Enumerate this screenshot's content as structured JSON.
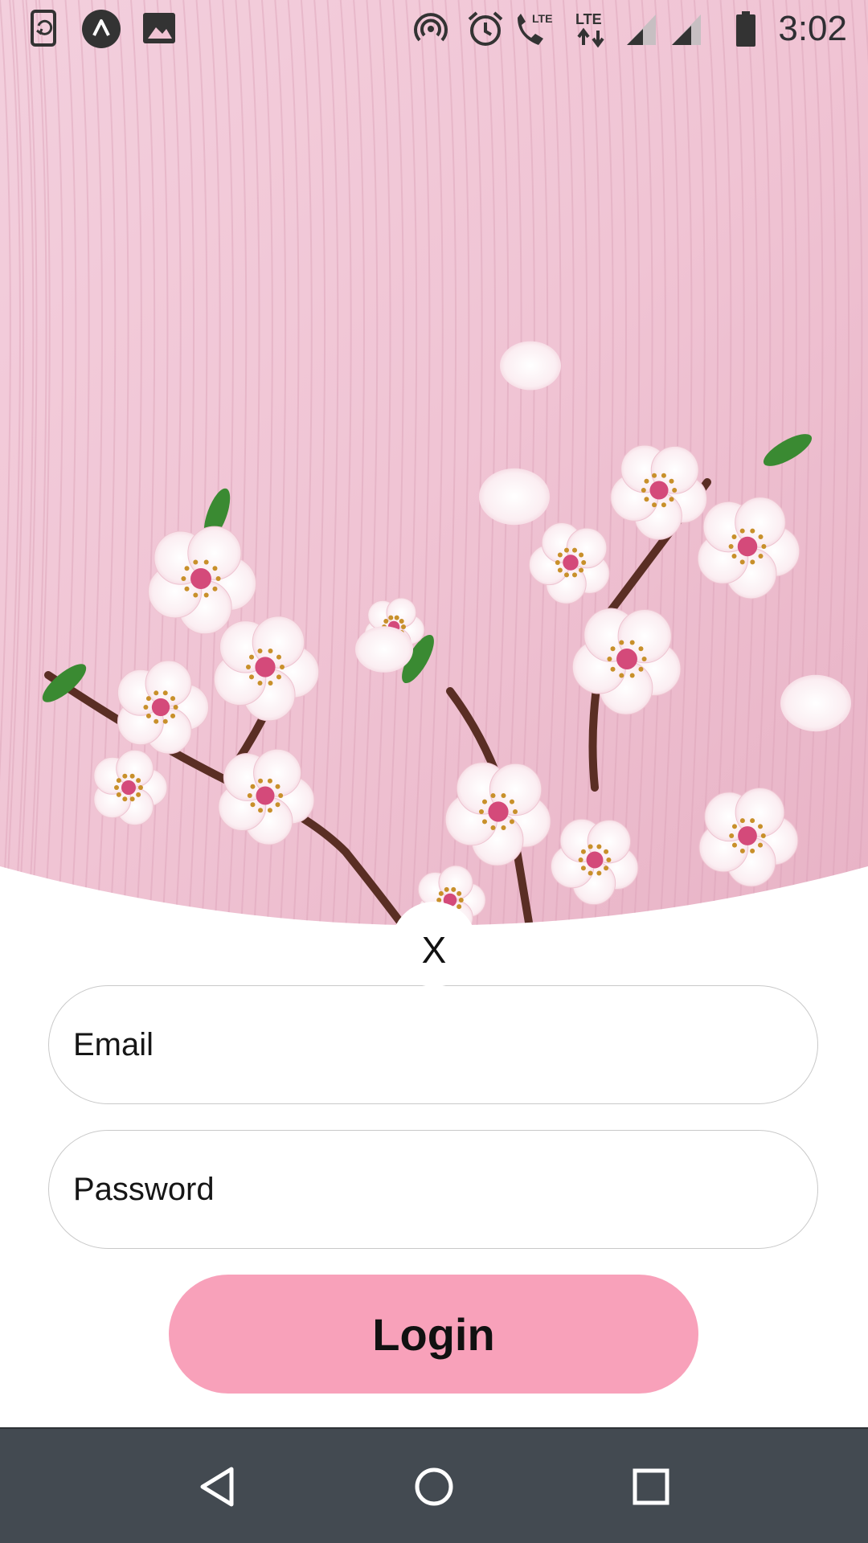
{
  "status_bar": {
    "time": "3:02",
    "left_icons": [
      "phone-sync-icon",
      "app-a-icon",
      "image-icon"
    ],
    "right_icons": [
      "hotspot-icon",
      "alarm-icon",
      "lte-call-icon",
      "lte-data-icon",
      "signal-1-icon",
      "signal-2-icon",
      "battery-icon"
    ],
    "lte_label": "LTE"
  },
  "hero": {
    "background_color": "#f2c4d4",
    "petal_color": "#fbe9ee",
    "center_color": "#d44a7a",
    "leaf_color": "#3a8a32"
  },
  "close_label": "X",
  "form": {
    "email_placeholder": "Email",
    "password_placeholder": "Password",
    "login_label": "Login",
    "accent_color": "#f8a1ba"
  },
  "nav_bar": {
    "buttons": [
      "back-icon",
      "home-icon",
      "recents-icon"
    ],
    "background_color": "#434a51"
  }
}
